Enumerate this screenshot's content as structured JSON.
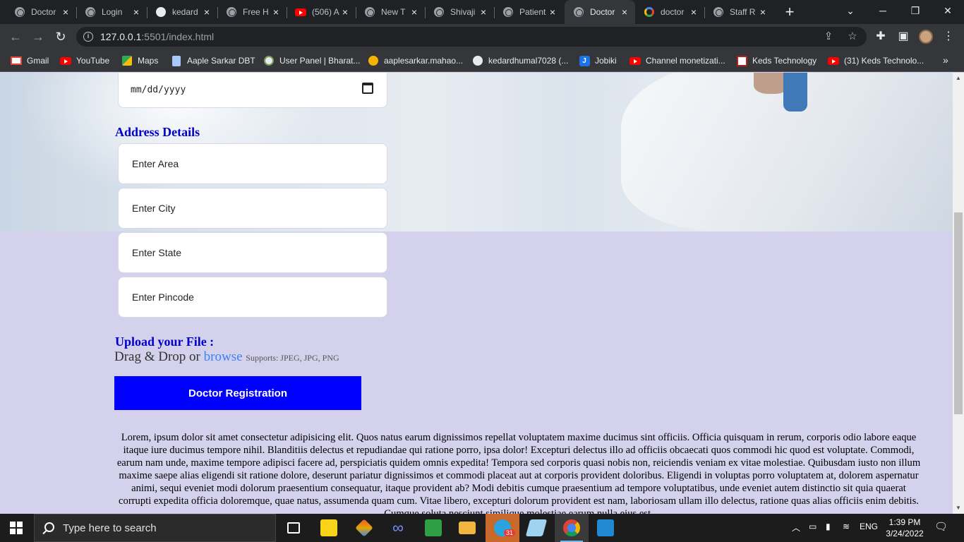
{
  "browser": {
    "tabs": [
      {
        "label": "Doctor",
        "icon": "globe-icon"
      },
      {
        "label": "Login",
        "icon": "globe-icon"
      },
      {
        "label": "kedard",
        "icon": "github-icon"
      },
      {
        "label": "Free H",
        "icon": "globe-icon"
      },
      {
        "label": "(506) A",
        "icon": "youtube-icon"
      },
      {
        "label": "New T",
        "icon": "chrome-icon"
      },
      {
        "label": "Shivaji",
        "icon": "globe-icon"
      },
      {
        "label": "Patient",
        "icon": "globe-icon"
      },
      {
        "label": "Doctor",
        "icon": "globe-icon",
        "active": true
      },
      {
        "label": "doctor",
        "icon": "google-icon"
      },
      {
        "label": "Staff R",
        "icon": "globe-icon"
      }
    ],
    "url_host": "127.0.0.1",
    "url_rest": ":5501/index.html",
    "bookmarks": [
      {
        "label": "Gmail",
        "icon": "gmail-icon"
      },
      {
        "label": "YouTube",
        "icon": "youtube-icon"
      },
      {
        "label": "Maps",
        "icon": "maps-icon"
      },
      {
        "label": "Aaple Sarkar DBT",
        "icon": "document-icon"
      },
      {
        "label": "User Panel | Bharat...",
        "icon": "emblem-icon"
      },
      {
        "label": "aaplesarkar.mahao...",
        "icon": "aaple-sarkar-icon"
      },
      {
        "label": "kedardhumal7028 (...",
        "icon": "github-icon"
      },
      {
        "label": "Jobiki",
        "icon": "jobiki-icon"
      },
      {
        "label": "Channel monetizati...",
        "icon": "youtube-icon"
      },
      {
        "label": "Keds Technology",
        "icon": "keds-icon"
      },
      {
        "label": "(31) Keds Technolo...",
        "icon": "youtube-icon"
      }
    ]
  },
  "form": {
    "dob_placeholder": "mm/dd/yyyy",
    "address_heading": "Address Details",
    "area_placeholder": "Enter Area",
    "city_placeholder": "Enter City",
    "state_placeholder": "State",
    "state_label": "Enter State",
    "pincode_placeholder": "Enter Pincode",
    "upload_heading": "Upload your File :",
    "drag_drop_text": "Drag & Drop or",
    "browse_link": "browse",
    "supports_text": "Supports: JPEG, JPG, PNG",
    "submit_label": "Doctor Registration"
  },
  "lorem_text": "Lorem, ipsum dolor sit amet consectetur adipisicing elit. Quos natus earum dignissimos repellat voluptatem maxime ducimus sint officiis. Officia quisquam in rerum, corporis odio labore eaque itaque iure ducimus tempore nihil. Blanditiis delectus et repudiandae qui ratione porro, ipsa dolor! Excepturi delectus illo ad officiis obcaecati quos commodi hic quod est voluptate. Commodi, earum nam unde, maxime tempore adipisci facere ad, perspiciatis quidem omnis expedita! Tempora sed corporis quasi nobis non, reiciendis veniam ex vitae molestiae. Quibusdam iusto non illum maxime saepe alias eligendi sit ratione dolore, deserunt pariatur dignissimos et commodi placeat aut at corporis provident doloribus. Eligendi in voluptas porro voluptatem at, dolorem aspernatur animi, sequi eveniet modi dolorum praesentium consequatur, itaque provident ab? Modi debitis cumque praesentium ad tempore voluptatibus, unde eveniet autem distinctio sit quia quaerat corrupti expedita officia doloremque, quae natus, assumenda quam cum. Vitae libero, excepturi dolorum provident est nam, laboriosam ullam illo delectus, ratione quas alias officiis enim debitis. Cumque soluta nesciunt similique molestiae earum nulla eius est.",
  "taskbar": {
    "search_placeholder": "Type here to search",
    "telegram_badge": "31",
    "language": "ENG",
    "time": "1:39 PM",
    "date": "3/24/2022"
  },
  "colors": {
    "page_bg": "#d4d1ec",
    "heading_blue": "#0000cc",
    "button_blue": "#0000ff",
    "link_blue": "#3b82f6"
  }
}
